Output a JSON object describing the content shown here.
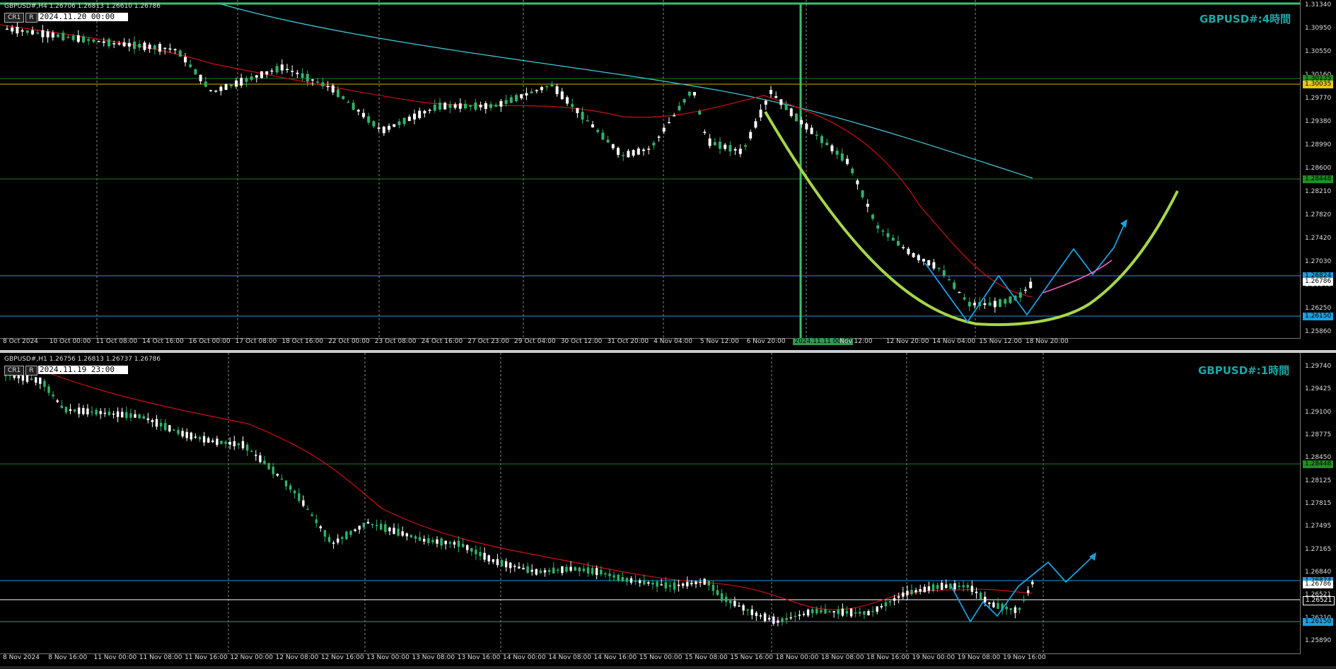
{
  "top": {
    "info": "GBPUSD#,H4  1.26706 1.26813 1.26610 1.26786",
    "cr_label": "CR1",
    "r_label": "R",
    "date_value": "2024.11.20  00:00",
    "tf_label": "GBPUSD#:4時間",
    "price_ticks": [
      "1.31340",
      "1.30950",
      "1.30550",
      "1.30160",
      "1.29770",
      "1.29380",
      "1.28990",
      "1.28600",
      "1.28210",
      "1.27820",
      "1.27420",
      "1.27030",
      "1.26640",
      "1.26250",
      "1.25860"
    ],
    "time_ticks": [
      "8 Oct 2024",
      "10 Oct 00:00",
      "11 Oct 08:00",
      "14 Oct 16:00",
      "16 Oct 00:00",
      "17 Oct 08:00",
      "18 Oct 16:00",
      "22 Oct 00:00",
      "23 Oct 08:00",
      "24 Oct 16:00",
      "27 Oct 23:00",
      "29 Oct 04:00",
      "30 Oct 12:00",
      "31 Oct 20:00",
      "4 Nov 04:00",
      "5 Nov 12:00",
      "6 Nov 20:00",
      "2024.11.11 00:00",
      "Nov 12:00",
      "12 Nov 20:00",
      "14 Nov 04:00",
      "15 Nov 12:00",
      "18 Nov 20:00"
    ],
    "tags": [
      {
        "text": "1.30135",
        "bg": "#1f8f1f"
      },
      {
        "text": "1.30035",
        "bg": "#e6c619"
      },
      {
        "text": "1.28448",
        "bg": "#1f8f1f"
      },
      {
        "text": "1.26824",
        "bg": "#1aa0e0"
      },
      {
        "text": "1.26786",
        "bg": "#ffffff"
      },
      {
        "text": "1.26150",
        "bg": "#1aa0e0"
      }
    ]
  },
  "bottom": {
    "info": "GBPUSD#,H1  1.26756 1.26813 1.26737 1.26786",
    "cr_label": "CR1",
    "r_label": "R",
    "date_value": "2024.11.19  23:00",
    "tf_label": "GBPUSD#:1時間",
    "price_ticks": [
      "1.29740",
      "1.29425",
      "1.29100",
      "1.28775",
      "1.28450",
      "1.28125",
      "1.27815",
      "1.27495",
      "1.27165",
      "1.26840",
      "1.26521",
      "1.26210",
      "1.25890"
    ],
    "time_ticks": [
      "8 Nov 2024",
      "8 Nov 16:00",
      "11 Nov 00:00",
      "11 Nov 08:00",
      "11 Nov 16:00",
      "12 Nov 00:00",
      "12 Nov 08:00",
      "12 Nov 16:00",
      "13 Nov 00:00",
      "13 Nov 08:00",
      "13 Nov 16:00",
      "14 Nov 00:00",
      "14 Nov 08:00",
      "14 Nov 16:00",
      "15 Nov 00:00",
      "15 Nov 08:00",
      "15 Nov 16:00",
      "18 Nov 00:00",
      "18 Nov 08:00",
      "18 Nov 16:00",
      "19 Nov 00:00",
      "19 Nov 08:00",
      "19 Nov 16:00"
    ],
    "tags": [
      {
        "text": "1.28448",
        "bg": "#1f8f1f"
      },
      {
        "text": "1.26824",
        "bg": "#1aa0e0"
      },
      {
        "text": "1.26786",
        "bg": "#ffffff"
      },
      {
        "text": "1.26521",
        "bg": "#000000"
      },
      {
        "text": "1.26150",
        "bg": "#1aa0e0"
      }
    ]
  },
  "colors": {
    "bull": "#2fb36b",
    "bear": "#ffffff",
    "ma_red": "#d01010",
    "ma_cyan": "#3fc9d9",
    "cup_green": "#a6d64a",
    "zigzag": "#1aa0e0",
    "pink": "#ff66cc",
    "level_blue": "#1a9ad6",
    "level_green": "#1e7a1e",
    "level_yellow": "#d4b000",
    "vline_green": "#3cc06a"
  }
}
